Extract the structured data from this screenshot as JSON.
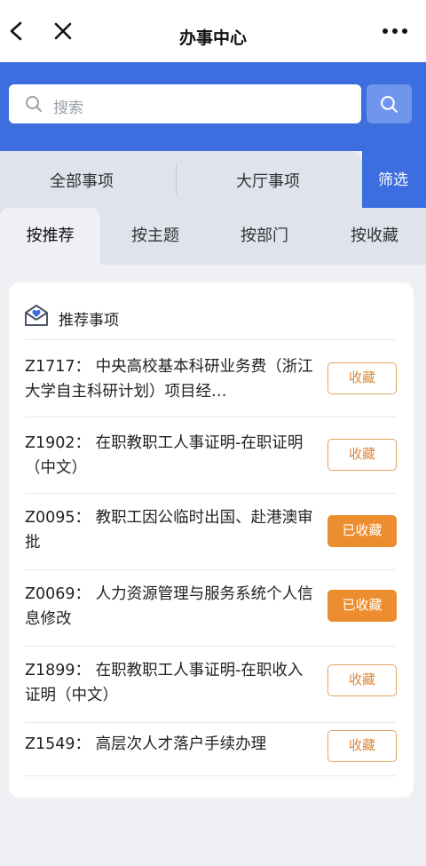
{
  "nav": {
    "title": "办事中心"
  },
  "search": {
    "placeholder": "搜索"
  },
  "category_tabs": [
    {
      "label": "全部事项"
    },
    {
      "label": "大厅事项"
    }
  ],
  "filter_label": "筛选",
  "sub_tabs": [
    {
      "label": "按推荐"
    },
    {
      "label": "按主题"
    },
    {
      "label": "按部门"
    },
    {
      "label": "按收藏"
    }
  ],
  "card": {
    "title": "推荐事项",
    "items": [
      {
        "text": "Z1717： 中央高校基本科研业务费（浙江大学自主科研计划）项目经…",
        "button": "收藏",
        "favorited": false
      },
      {
        "text": "Z1902： 在职教职工人事证明-在职证明（中文）",
        "button": "收藏",
        "favorited": false
      },
      {
        "text": "Z0095： 教职工因公临时出国、赴港澳审批",
        "button": "已收藏",
        "favorited": true
      },
      {
        "text": "Z0069： 人力资源管理与服务系统个人信息修改",
        "button": "已收藏",
        "favorited": true
      },
      {
        "text": "Z1899： 在职教职工人事证明-在职收入证明（中文）",
        "button": "收藏",
        "favorited": false
      },
      {
        "text": "Z1549： 高层次人才落户手续办理",
        "button": "收藏",
        "favorited": false
      }
    ]
  },
  "colors": {
    "primary": "#3c6ee0",
    "accent": "#ec8e2f"
  }
}
